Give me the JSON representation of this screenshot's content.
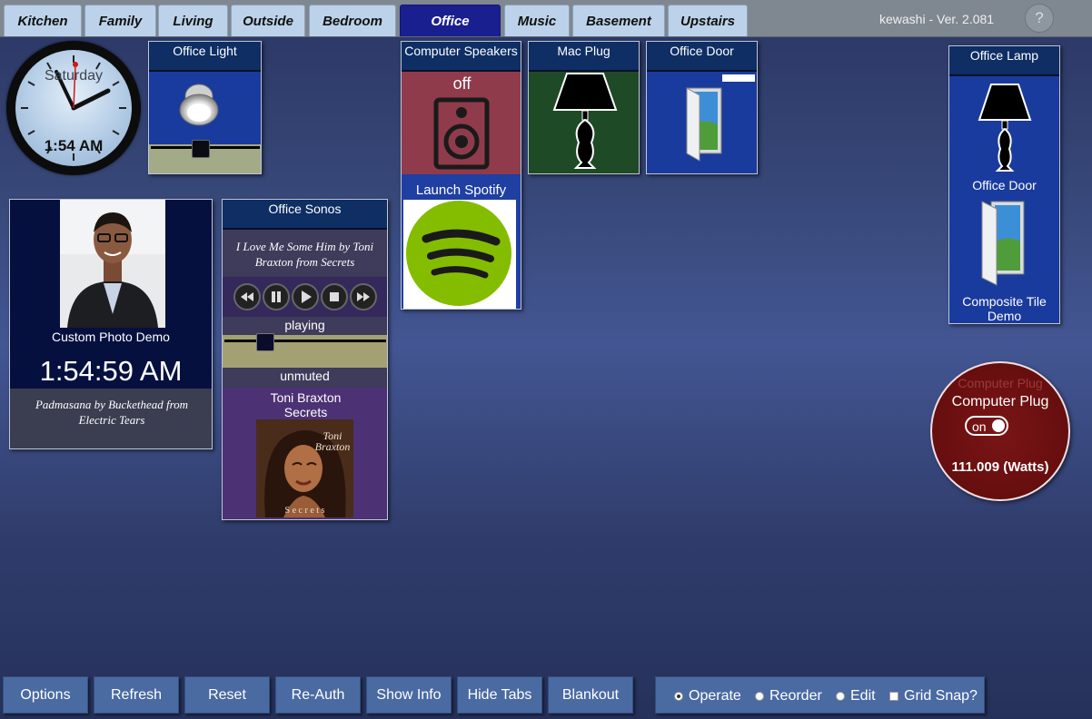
{
  "tabs": [
    {
      "label": "Kitchen"
    },
    {
      "label": "Family"
    },
    {
      "label": "Living"
    },
    {
      "label": "Outside"
    },
    {
      "label": "Bedroom"
    },
    {
      "label": "Office"
    },
    {
      "label": "Music"
    },
    {
      "label": "Basement"
    },
    {
      "label": "Upstairs"
    }
  ],
  "active_tab": "Office",
  "brand": "kewashi - Ver. 2.081",
  "help_label": "?",
  "clock": {
    "day": "Saturday",
    "time": "1:54 AM"
  },
  "office_light": {
    "title": "Office Light",
    "level": 0.4,
    "icon": "light-bulb-icon"
  },
  "computer_speakers": {
    "title": "Computer Speakers",
    "state": "off",
    "icon": "speaker-icon",
    "launch_label": "Launch Spotify",
    "launch_icon": "spotify-icon"
  },
  "mac_plug": {
    "title": "Mac Plug",
    "icon": "lamp-icon"
  },
  "office_door": {
    "title": "Office Door",
    "icon": "door-icon"
  },
  "office_lamp": {
    "title": "Office Lamp",
    "door_label": "Office Door",
    "composite_label": "Composite Tile Demo"
  },
  "photo_tile": {
    "caption": "Custom Photo Demo",
    "time": "1:54:59 AM",
    "track": "Padmasana by Buckethead from Electric Tears"
  },
  "sonos": {
    "title": "Office Sonos",
    "track": "I Love Me Some Him by Toni Braxton from Secrets",
    "status": "playing",
    "volume": 0.2,
    "mute": "unmuted",
    "artist": "Toni Braxton",
    "album": "Secrets",
    "album_art_text": "Toni Braxton",
    "album_art_footer": "S e c r e t s"
  },
  "computer_plug": {
    "ghost_title": "Computer Plug",
    "title": "Computer Plug",
    "switch": "on",
    "power": "111.009 (Watts)"
  },
  "bottom_buttons": [
    "Options",
    "Refresh",
    "Reset",
    "Re-Auth",
    "Show Info",
    "Hide Tabs",
    "Blankout"
  ],
  "modes": {
    "operate": "Operate",
    "reorder": "Reorder",
    "edit": "Edit",
    "grid": "Grid Snap?",
    "selected": "Operate"
  },
  "colors": {
    "tab_active": "#1a1f8f",
    "tile_blue": "#1a3b9e",
    "speaker_off": "#8f3b4c",
    "plug_red": "#6e0f10"
  }
}
